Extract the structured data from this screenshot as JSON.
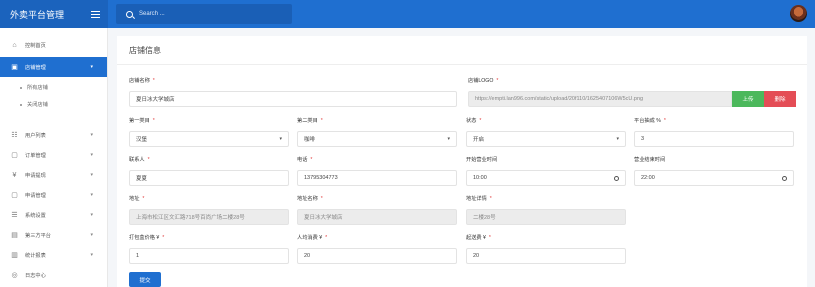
{
  "header": {
    "app_title": "外卖平台管理",
    "search_placeholder": "Search ..."
  },
  "sidebar": {
    "items": [
      {
        "label": "控制首页",
        "icon": "home-icon"
      },
      {
        "label": "店铺管理",
        "icon": "store-icon",
        "active": true
      },
      {
        "label": "用户列表",
        "icon": "users-icon"
      },
      {
        "label": "订单管理",
        "icon": "order-icon"
      },
      {
        "label": "申请提现",
        "icon": "yen-icon"
      },
      {
        "label": "申请管理",
        "icon": "apply-icon"
      },
      {
        "label": "系统设置",
        "icon": "settings-icon"
      },
      {
        "label": "第三方平台",
        "icon": "platform-icon"
      },
      {
        "label": "统计报表",
        "icon": "chart-icon"
      },
      {
        "label": "日志中心",
        "icon": "log-icon"
      }
    ],
    "sub_items": [
      "所有店铺",
      "关闭店铺"
    ]
  },
  "page": {
    "title": "店铺信息",
    "submit_label": "提交"
  },
  "form": {
    "shop_name": {
      "label": "店铺名称",
      "value": "夏日冰大学城店"
    },
    "shop_logo": {
      "label": "店铺LOGO",
      "value": "https://empti.lan996.com/static/upload/20f110/1625407106W5cU.png",
      "upload_label": "上传",
      "delete_label": "删除"
    },
    "category1": {
      "label": "第一类目",
      "value": "汉堡"
    },
    "category2": {
      "label": "第二类目",
      "value": "咖啡"
    },
    "status": {
      "label": "状态",
      "value": "开启"
    },
    "commission": {
      "label": "平台抽成 %",
      "value": "3"
    },
    "contact": {
      "label": "联系人",
      "value": "夏夏"
    },
    "phone": {
      "label": "电话",
      "value": "13795304773"
    },
    "open_time": {
      "label": "开始营业时间",
      "value": "10:00"
    },
    "close_time": {
      "label": "营业结束时间",
      "value": "22:00"
    },
    "address": {
      "label": "地址",
      "value": "上海市松江区文汇路718号百尚广场二楼28号"
    },
    "address_name": {
      "label": "地址名称",
      "value": "夏日冰大学城店"
    },
    "address_detail": {
      "label": "地址详情",
      "value": "二楼28号"
    },
    "packing_fee": {
      "label": "打包盒价格 ¥",
      "value": "1"
    },
    "avg_spend": {
      "label": "人均消费 ¥",
      "value": "20"
    },
    "min_delivery": {
      "label": "起送费 ¥",
      "value": "20"
    }
  },
  "colors": {
    "primary": "#1f6fd0",
    "upload": "#4cb85c",
    "delete": "#e44d56"
  }
}
